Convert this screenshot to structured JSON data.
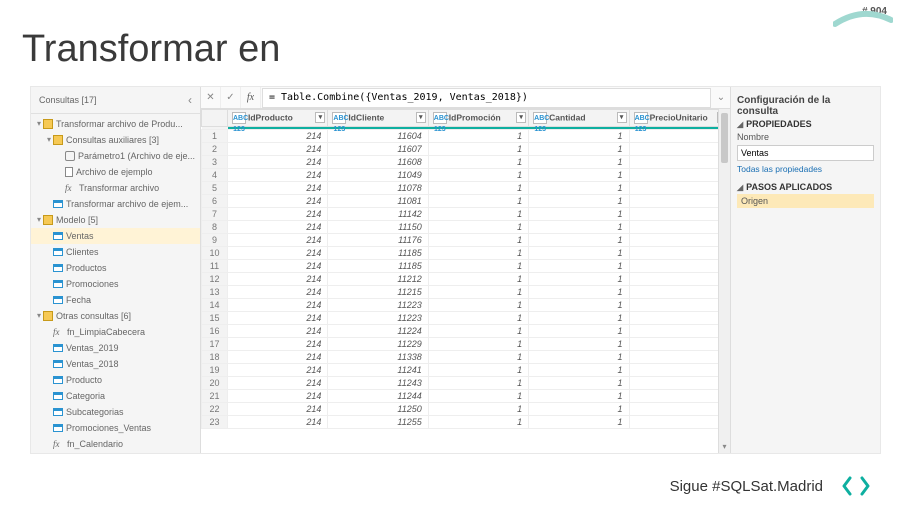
{
  "page_number": "# 904",
  "title": "Transformar en",
  "footer_text": "Sigue #SQLSat.Madrid",
  "queries_header": "Consultas [17]",
  "tree": [
    {
      "indent": 0,
      "icon": "folder",
      "caret": "▾",
      "label": "Transformar archivo de Produ..."
    },
    {
      "indent": 1,
      "icon": "folder",
      "caret": "▾",
      "label": "Consultas auxiliares [3]"
    },
    {
      "indent": 2,
      "icon": "param",
      "caret": "",
      "label": "Parámetro1 (Archivo de eje..."
    },
    {
      "indent": 2,
      "icon": "doc",
      "caret": "",
      "label": "Archivo de ejemplo"
    },
    {
      "indent": 2,
      "icon": "fx",
      "caret": "",
      "label": "Transformar archivo"
    },
    {
      "indent": 1,
      "icon": "table",
      "caret": "",
      "label": "Transformar archivo de ejem..."
    },
    {
      "indent": 0,
      "icon": "folder",
      "caret": "▾",
      "label": "Modelo [5]"
    },
    {
      "indent": 1,
      "icon": "table",
      "caret": "",
      "label": "Ventas",
      "selected": true
    },
    {
      "indent": 1,
      "icon": "table",
      "caret": "",
      "label": "Clientes"
    },
    {
      "indent": 1,
      "icon": "table",
      "caret": "",
      "label": "Productos"
    },
    {
      "indent": 1,
      "icon": "table",
      "caret": "",
      "label": "Promociones"
    },
    {
      "indent": 1,
      "icon": "table",
      "caret": "",
      "label": "Fecha"
    },
    {
      "indent": 0,
      "icon": "folder",
      "caret": "▾",
      "label": "Otras consultas [6]"
    },
    {
      "indent": 1,
      "icon": "fx",
      "caret": "",
      "label": "fn_LimpiaCabecera"
    },
    {
      "indent": 1,
      "icon": "table",
      "caret": "",
      "label": "Ventas_2019"
    },
    {
      "indent": 1,
      "icon": "table",
      "caret": "",
      "label": "Ventas_2018"
    },
    {
      "indent": 1,
      "icon": "table",
      "caret": "",
      "label": "Producto"
    },
    {
      "indent": 1,
      "icon": "table",
      "caret": "",
      "label": "Categoria"
    },
    {
      "indent": 1,
      "icon": "table",
      "caret": "",
      "label": "Subcategorias"
    },
    {
      "indent": 1,
      "icon": "table",
      "caret": "",
      "label": "Promociones_Ventas"
    },
    {
      "indent": 1,
      "icon": "fx",
      "caret": "",
      "label": "fn_Calendario"
    }
  ],
  "formula": "= Table.Combine({Ventas_2019, Ventas_2018})",
  "columns": [
    "IdProducto",
    "IdCliente",
    "IdPromoción",
    "Cantidad",
    "PrecioUnitario"
  ],
  "col_type_label": "ABC 123",
  "rows": [
    {
      "n": 1,
      "c": [
        214,
        11604,
        1,
        1,
        ""
      ]
    },
    {
      "n": 2,
      "c": [
        214,
        11607,
        1,
        1,
        ""
      ]
    },
    {
      "n": 3,
      "c": [
        214,
        11608,
        1,
        1,
        ""
      ]
    },
    {
      "n": 4,
      "c": [
        214,
        11049,
        1,
        1,
        ""
      ]
    },
    {
      "n": 5,
      "c": [
        214,
        11078,
        1,
        1,
        ""
      ]
    },
    {
      "n": 6,
      "c": [
        214,
        11081,
        1,
        1,
        ""
      ]
    },
    {
      "n": 7,
      "c": [
        214,
        11142,
        1,
        1,
        ""
      ]
    },
    {
      "n": 8,
      "c": [
        214,
        11150,
        1,
        1,
        ""
      ]
    },
    {
      "n": 9,
      "c": [
        214,
        11176,
        1,
        1,
        ""
      ]
    },
    {
      "n": 10,
      "c": [
        214,
        11185,
        1,
        1,
        ""
      ]
    },
    {
      "n": 11,
      "c": [
        214,
        11185,
        1,
        1,
        ""
      ]
    },
    {
      "n": 12,
      "c": [
        214,
        11212,
        1,
        1,
        ""
      ]
    },
    {
      "n": 13,
      "c": [
        214,
        11215,
        1,
        1,
        ""
      ]
    },
    {
      "n": 14,
      "c": [
        214,
        11223,
        1,
        1,
        ""
      ]
    },
    {
      "n": 15,
      "c": [
        214,
        11223,
        1,
        1,
        ""
      ]
    },
    {
      "n": 16,
      "c": [
        214,
        11224,
        1,
        1,
        ""
      ]
    },
    {
      "n": 17,
      "c": [
        214,
        11229,
        1,
        1,
        ""
      ]
    },
    {
      "n": 18,
      "c": [
        214,
        11338,
        1,
        1,
        ""
      ]
    },
    {
      "n": 19,
      "c": [
        214,
        11241,
        1,
        1,
        ""
      ]
    },
    {
      "n": 20,
      "c": [
        214,
        11243,
        1,
        1,
        ""
      ]
    },
    {
      "n": 21,
      "c": [
        214,
        11244,
        1,
        1,
        ""
      ]
    },
    {
      "n": 22,
      "c": [
        214,
        11250,
        1,
        1,
        ""
      ]
    },
    {
      "n": 23,
      "c": [
        214,
        11255,
        1,
        1,
        ""
      ]
    }
  ],
  "settings": {
    "panel_title": "Configuración de la consulta",
    "props_header": "PROPIEDADES",
    "name_label": "Nombre",
    "name_value": "Ventas",
    "all_props": "Todas las propiedades",
    "steps_header": "PASOS APLICADOS",
    "step1": "Origen"
  }
}
